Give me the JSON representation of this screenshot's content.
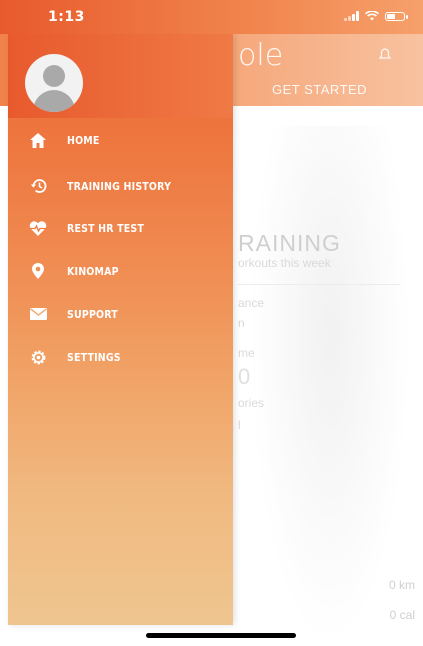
{
  "status_bar": {
    "time": "1:13"
  },
  "background_app": {
    "logo": "ole",
    "header_cta": "GET STARTED",
    "section_title": "RAINING",
    "section_subtitle": "orkouts this week",
    "stat_distance_label": "ance",
    "stat_distance_unit": "n",
    "stat_time_label": "me",
    "stat_time_value": "0",
    "stat_calories_label": "ories",
    "stat_calories_unit": "l",
    "bottom_km": "0 km",
    "bottom_cal": "0 cal"
  },
  "drawer": {
    "items": [
      {
        "label": "HOME",
        "icon": "home-icon"
      },
      {
        "label": "TRAINING HISTORY",
        "icon": "history-icon"
      },
      {
        "label": "REST HR TEST",
        "icon": "heart-rate-icon"
      },
      {
        "label": "KINOMAP",
        "icon": "map-pin-icon"
      },
      {
        "label": "SUPPORT",
        "icon": "mail-icon"
      },
      {
        "label": "SETTINGS",
        "icon": "gear-icon"
      }
    ]
  },
  "colors": {
    "accent": "#e85a2d",
    "drawer_bottom": "#efc58f"
  }
}
